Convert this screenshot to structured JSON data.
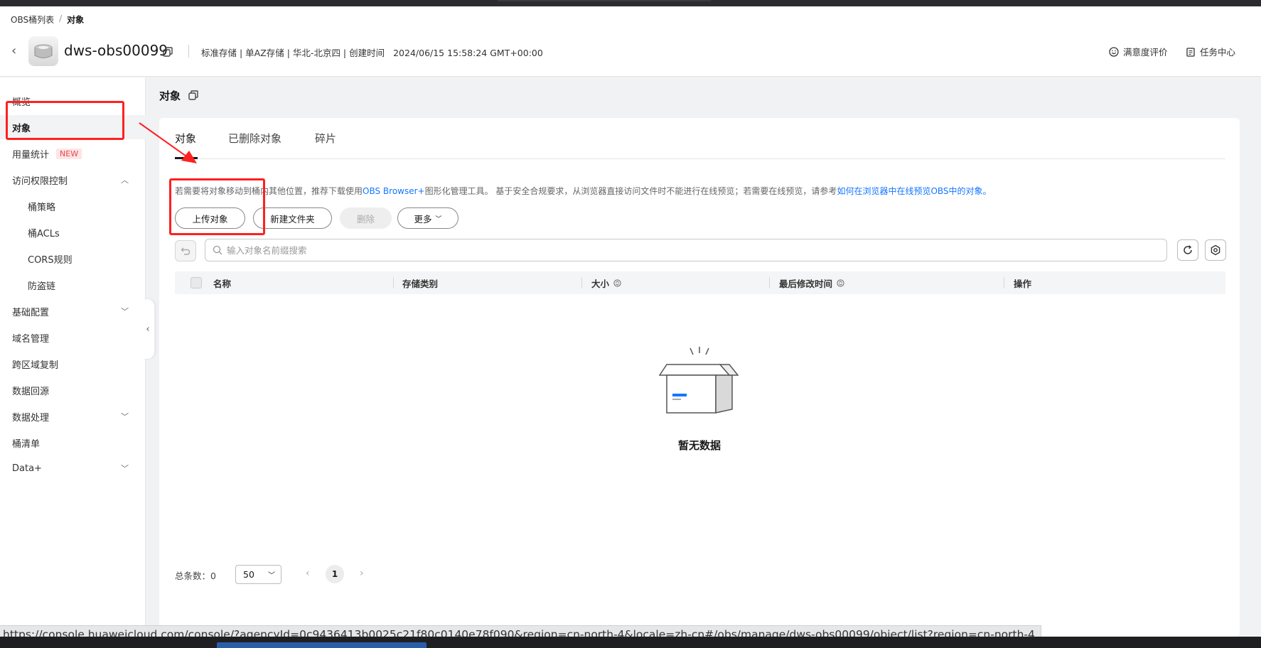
{
  "breadcrumb": {
    "root": "OBS桶列表",
    "separator": "/",
    "current": "对象"
  },
  "header": {
    "bucket_name": "dws-obs00099",
    "meta": "标准存储 | 单AZ存储 | 华北-北京四 | 创建时间",
    "created_time": "2024/06/15 15:58:24 GMT+00:00",
    "actions": {
      "feedback": "满意度评价",
      "task_center": "任务中心"
    }
  },
  "sidebar": {
    "items": [
      {
        "label": "概览"
      },
      {
        "label": "对象"
      },
      {
        "label": "用量统计",
        "badge": "NEW"
      },
      {
        "label": "访问权限控制"
      },
      {
        "label": "桶策略"
      },
      {
        "label": "桶ACLs"
      },
      {
        "label": "CORS规则"
      },
      {
        "label": "防盗链"
      },
      {
        "label": "基础配置"
      },
      {
        "label": "域名管理"
      },
      {
        "label": "跨区域复制"
      },
      {
        "label": "数据回源"
      },
      {
        "label": "数据处理"
      },
      {
        "label": "桶清单"
      },
      {
        "label": "Data+"
      }
    ]
  },
  "main": {
    "title": "对象",
    "tabs": [
      {
        "label": "对象"
      },
      {
        "label": "已删除对象"
      },
      {
        "label": "碎片"
      }
    ],
    "notice": {
      "prefix": "若需要将对象移动到桶内其他位置，推荐下载使用",
      "link1": "OBS Browser+",
      "middle": "图形化管理工具。 基于安全合规要求，从浏览器直接访问文件时不能进行在线预览；若需要在线预览，请参考",
      "link2": "如何在浏览器中在线预览OBS中的对象。"
    },
    "buttons": {
      "upload": "上传对象",
      "new_folder": "新建文件夹",
      "delete": "删除",
      "more": "更多"
    },
    "search": {
      "placeholder": "输入对象名前缀搜索"
    },
    "table": {
      "columns": [
        {
          "label": "名称"
        },
        {
          "label": "存储类别"
        },
        {
          "label": "大小"
        },
        {
          "label": "最后修改时间"
        },
        {
          "label": "操作"
        }
      ]
    },
    "empty_text": "暂无数据",
    "pager": {
      "total_label": "总条数：0",
      "page_size": "50",
      "current_page": "1"
    }
  },
  "status_url": "https://console.huaweicloud.com/console/?agencyId=0c9436413b0025c21f80c0140e78f090&region=cn-north-4&locale=zh-cn#/obs/manage/dws-obs00099/object/list?region=cn-north-4",
  "colors": {
    "accent": "#1476ff",
    "annotation": "#ff2020",
    "badge_red": "#e5484d"
  }
}
